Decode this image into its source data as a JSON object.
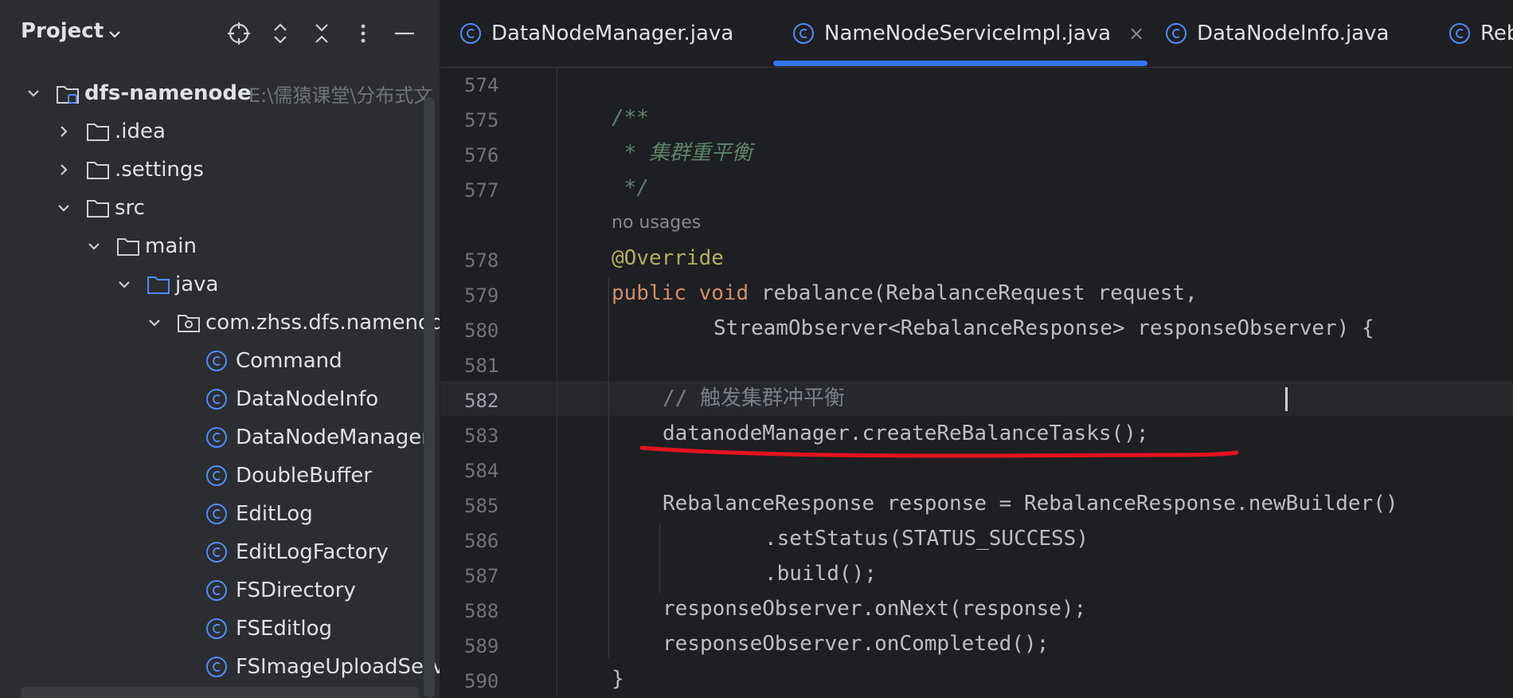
{
  "project_panel": {
    "title": "Project",
    "tree": [
      {
        "label": "dfs-namenode",
        "path": "E:\\儒猿课堂\\分布式文"
      },
      {
        "label": ".idea"
      },
      {
        "label": ".settings"
      },
      {
        "label": "src"
      },
      {
        "label": "main"
      },
      {
        "label": "java"
      },
      {
        "label": "com.zhss.dfs.namenode"
      },
      {
        "label": "Command"
      },
      {
        "label": "DataNodeInfo"
      },
      {
        "label": "DataNodeManager"
      },
      {
        "label": "DoubleBuffer"
      },
      {
        "label": "EditLog"
      },
      {
        "label": "EditLogFactory"
      },
      {
        "label": "FSDirectory"
      },
      {
        "label": "FSEditlog"
      },
      {
        "label": "FSImageUploadServer"
      }
    ]
  },
  "tabs": [
    {
      "label": "DataNodeManager.java"
    },
    {
      "label": "NameNodeServiceImpl.java",
      "close": "×"
    },
    {
      "label": "DataNodeInfo.java"
    },
    {
      "label": "RebalanceRequest.java"
    }
  ],
  "editor": {
    "line_numbers": [
      "574",
      "575",
      "576",
      "577",
      "578",
      "579",
      "580",
      "581",
      "582",
      "583",
      "584",
      "585",
      "586",
      "587",
      "588",
      "589",
      "590"
    ],
    "hint": "no usages",
    "code": {
      "l575": "/**",
      "l576": " * 集群重平衡",
      "l577": " */",
      "l578": "@Override",
      "l579_kw": "public void",
      "l579_rest": " rebalance(RebalanceRequest request,",
      "l580": "StreamObserver<RebalanceResponse> responseObserver) {",
      "l582": "// 触发集群冲平衡",
      "l583": "datanodeManager.createReBalanceTasks();",
      "l585": "RebalanceResponse response = RebalanceResponse.newBuilder()",
      "l586": ".setStatus(STATUS_SUCCESS)",
      "l587": ".build();",
      "l588": "responseObserver.onNext(response);",
      "l589": "responseObserver.onCompleted();",
      "l590": "}"
    }
  },
  "colors": {
    "accent": "#3574f0",
    "annotation_underline": "#e3141e",
    "class_icon": "#548af7"
  }
}
